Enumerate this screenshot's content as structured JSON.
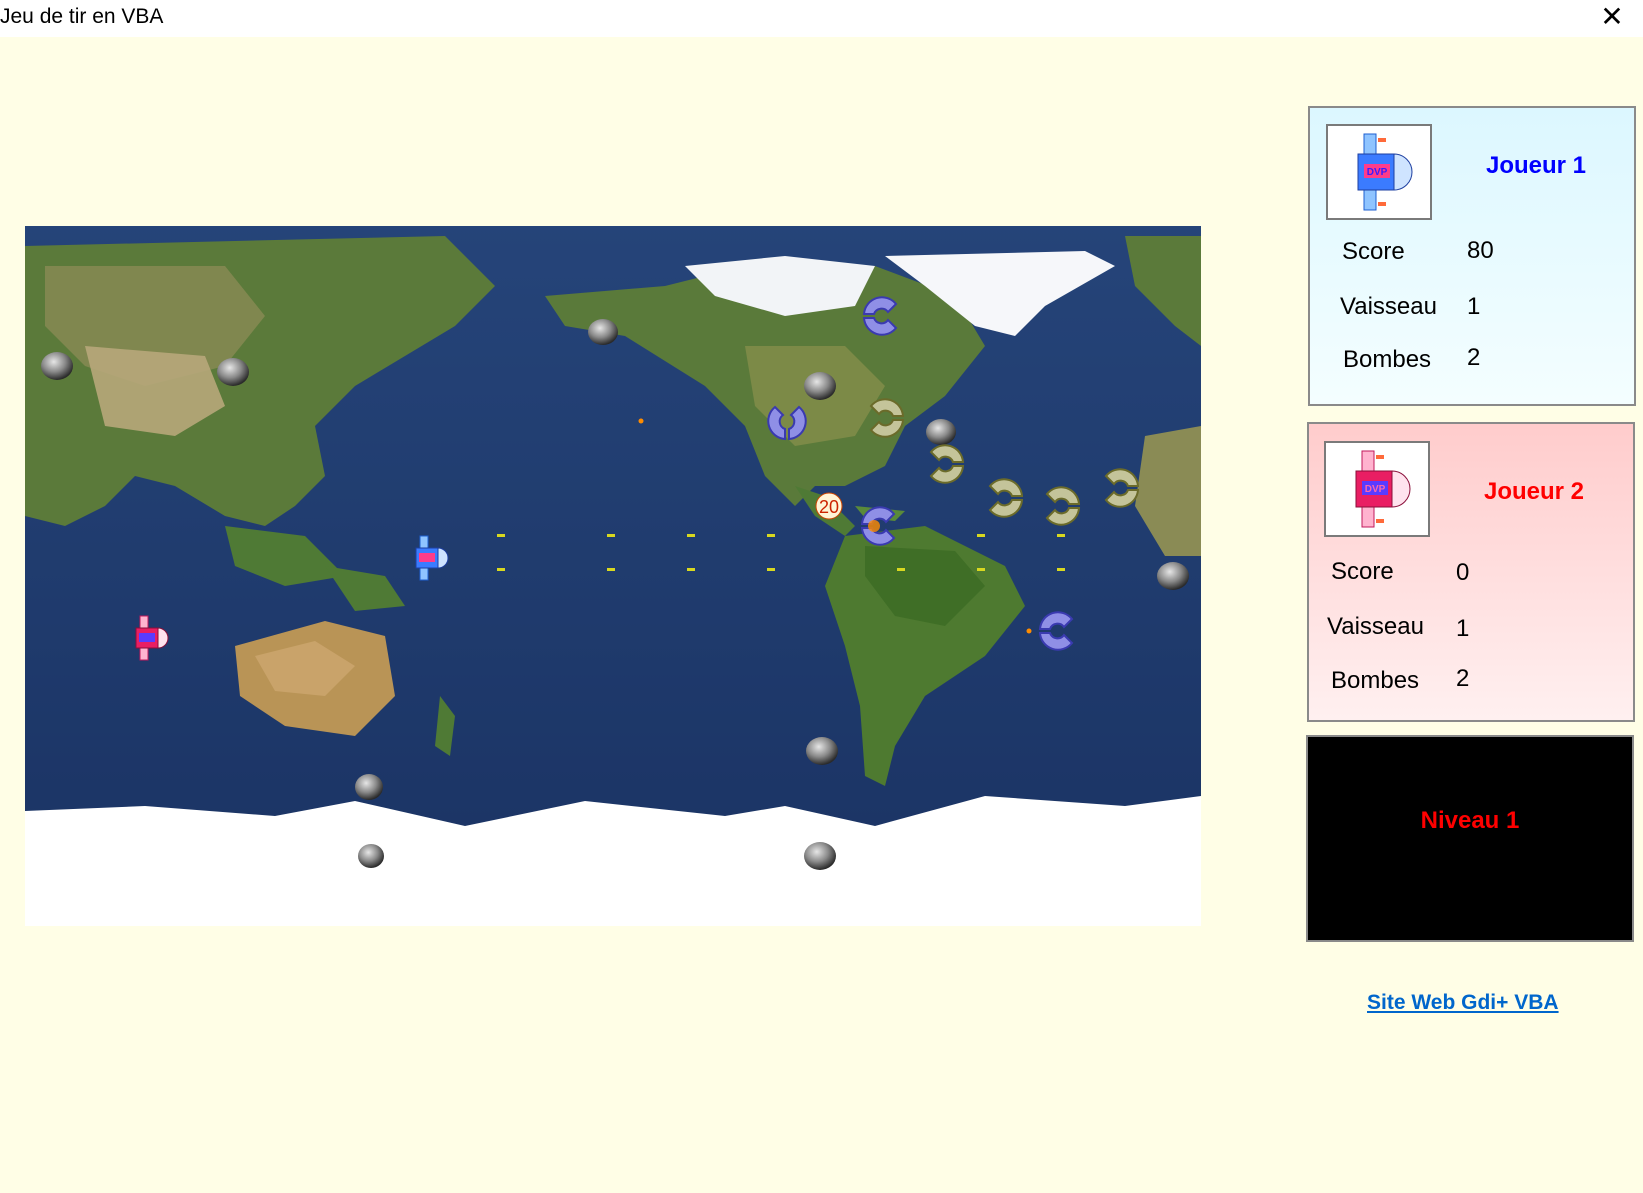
{
  "window": {
    "title": "Jeu de tir en VBA",
    "close_glyph": "✕"
  },
  "player1": {
    "name": "Joueur 1",
    "name_color": "#0000ff",
    "avatar_icon": "blue-spaceship-icon",
    "stats": [
      {
        "label": "Score",
        "value": "80"
      },
      {
        "label": "Vaisseau",
        "value": "1"
      },
      {
        "label": "Bombes",
        "value": "2"
      }
    ]
  },
  "player2": {
    "name": "Joueur 2",
    "name_color": "#ff0000",
    "avatar_icon": "pink-spaceship-icon",
    "stats": [
      {
        "label": "Score",
        "value": "0"
      },
      {
        "label": "Vaisseau",
        "value": "1"
      },
      {
        "label": "Bombes",
        "value": "2"
      }
    ]
  },
  "level": {
    "text": "Niveau 1"
  },
  "link": {
    "text": "Site Web Gdi+ VBA"
  },
  "game": {
    "points_popup": "20",
    "ship_badge": "DVP"
  }
}
